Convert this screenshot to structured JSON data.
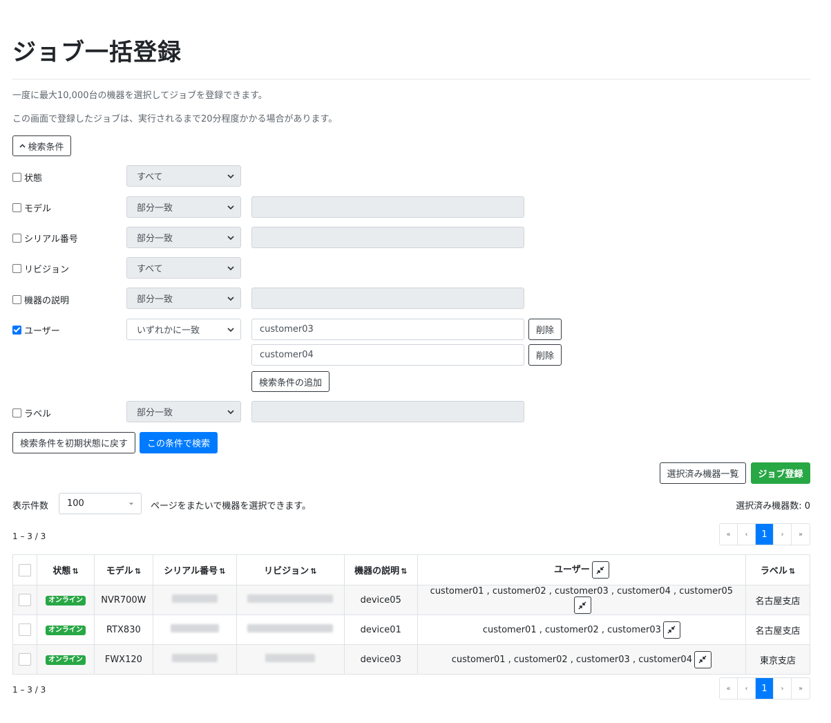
{
  "page": {
    "title": "ジョブ一括登録",
    "desc1": "一度に最大10,000台の機器を選択してジョブを登録できます。",
    "desc2": "この画面で登録したジョブは、実行されるまで20分程度かかる場合があります。"
  },
  "search": {
    "toggle_label": "検索条件",
    "rows": {
      "status": {
        "label": "状態",
        "select": "すべて"
      },
      "model": {
        "label": "モデル",
        "select": "部分一致"
      },
      "serial": {
        "label": "シリアル番号",
        "select": "部分一致"
      },
      "revision": {
        "label": "リビジョン",
        "select": "すべて"
      },
      "desc": {
        "label": "機器の説明",
        "select": "部分一致"
      },
      "user": {
        "label": "ユーザー",
        "select": "いずれかに一致",
        "value1": "customer03",
        "value2": "customer04"
      },
      "label": {
        "label": "ラベル",
        "select": "部分一致"
      }
    },
    "delete_label": "削除",
    "add_condition_label": "検索条件の追加",
    "reset_label": "検索条件を初期状態に戻す",
    "search_label": "この条件で検索"
  },
  "actions": {
    "selected_list_label": "選択済み機器一覧",
    "register_label": "ジョブ登録"
  },
  "list": {
    "per_page_label": "表示件数",
    "per_page_value": "100",
    "cross_page_note": "ページをまたいで機器を選択できます。",
    "selected_count": "選択済み機器数: 0",
    "range_text": "1 – 3 / 3",
    "pager": {
      "first": "«",
      "prev": "‹",
      "page": "1",
      "next": "›",
      "last": "»"
    }
  },
  "table": {
    "headers": {
      "status": "状態",
      "model": "モデル",
      "serial": "シリアル番号",
      "revision": "リビジョン",
      "desc": "機器の説明",
      "user": "ユーザー",
      "label": "ラベル"
    },
    "rows": [
      {
        "status": "オンライン",
        "model": "NVR700W",
        "desc": "device05",
        "users": "customer01 , customer02 , customer03 , customer04 , customer05",
        "label": "名古屋支店"
      },
      {
        "status": "オンライン",
        "model": "RTX830",
        "desc": "device01",
        "users": "customer01 , customer02 , customer03",
        "label": "名古屋支店"
      },
      {
        "status": "オンライン",
        "model": "FWX120",
        "desc": "device03",
        "users": "customer01 , customer02 , customer03 , customer04",
        "label": "東京支店"
      }
    ]
  }
}
